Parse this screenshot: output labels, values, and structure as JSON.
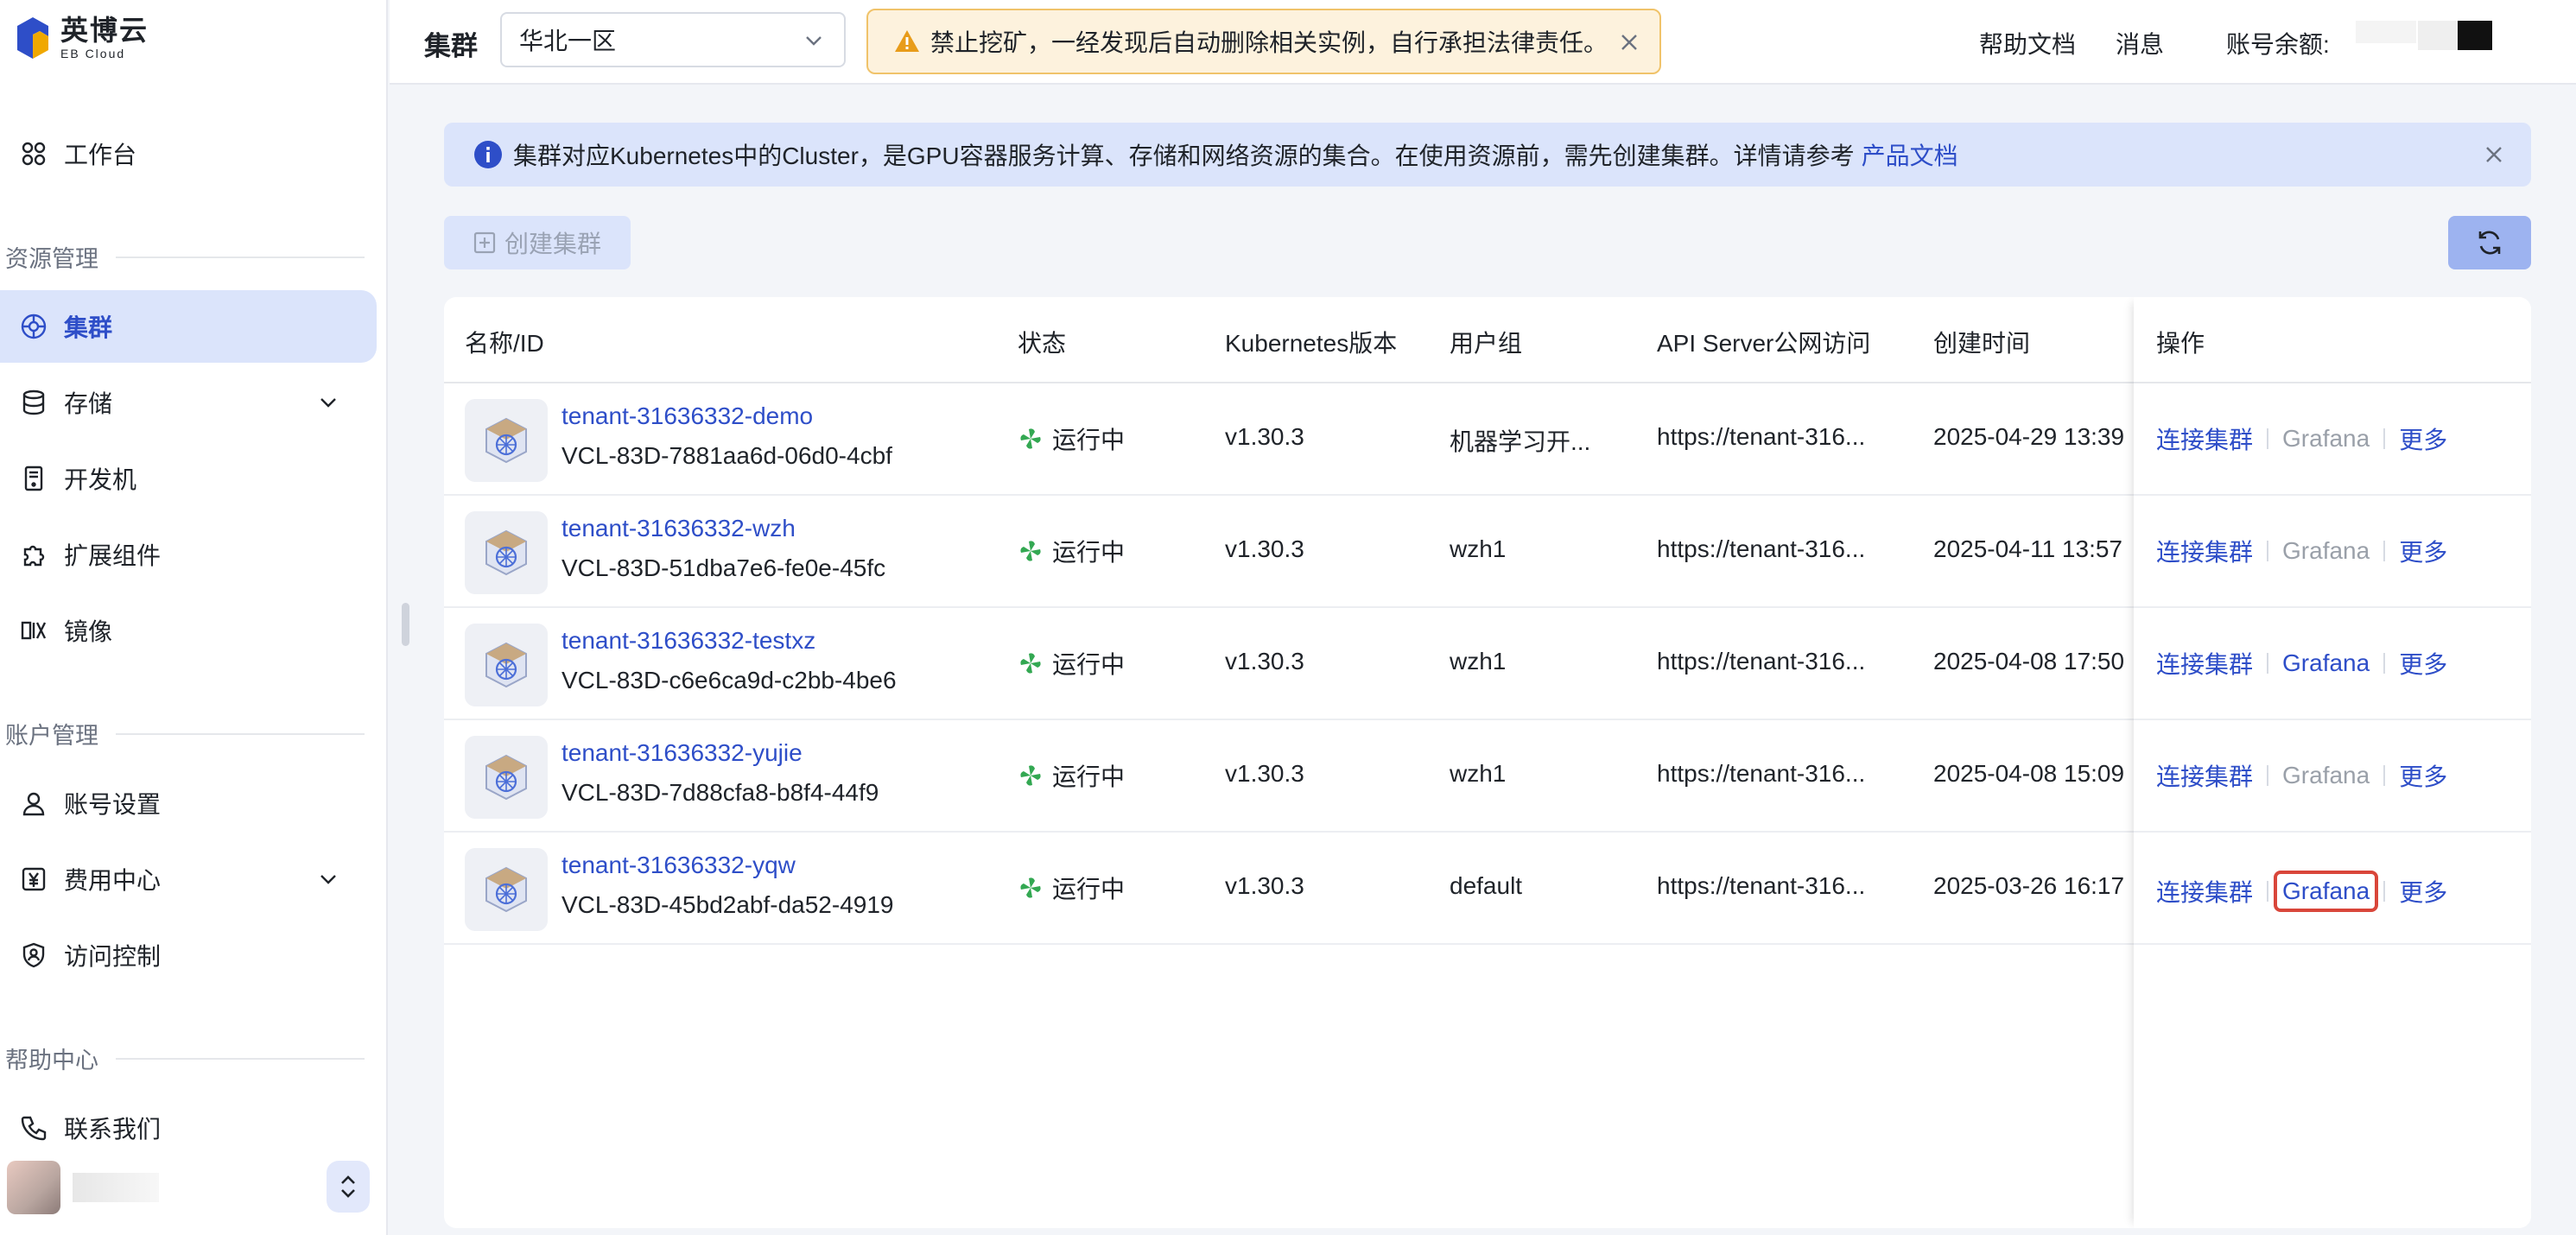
{
  "brand": {
    "name_cn": "英博云",
    "name_en": "EB Cloud",
    "color": "#2e4ec8"
  },
  "sidebar": {
    "workbench": "工作台",
    "section_resource": "资源管理",
    "items_resource": [
      {
        "label": "集群",
        "icon": "cluster-icon",
        "active": true
      },
      {
        "label": "存储",
        "icon": "database-icon",
        "expandable": true
      },
      {
        "label": "开发机",
        "icon": "device-icon"
      },
      {
        "label": "扩展组件",
        "icon": "puzzle-icon"
      },
      {
        "label": "镜像",
        "icon": "image-icon"
      }
    ],
    "section_account": "账户管理",
    "items_account": [
      {
        "label": "账号设置",
        "icon": "user-icon"
      },
      {
        "label": "费用中心",
        "icon": "yen-icon",
        "expandable": true
      },
      {
        "label": "访问控制",
        "icon": "shield-user-icon"
      }
    ],
    "section_help": "帮助中心",
    "items_help": [
      {
        "label": "联系我们",
        "icon": "phone-icon"
      }
    ]
  },
  "header": {
    "title": "集群",
    "region": "华北一区",
    "warning": "禁止挖矿，一经发现后自动删除相关实例，自行承担法律责任。",
    "help_docs": "帮助文档",
    "messages": "消息",
    "balance_label": "账号余额:"
  },
  "info_banner": {
    "text": "集群对应Kubernetes中的Cluster，是GPU容器服务计算、存储和网络资源的集合。在使用资源前，需先创建集群。详情请参考",
    "link": "产品文档"
  },
  "toolbar": {
    "create_label": "创建集群"
  },
  "table": {
    "columns": [
      "名称/ID",
      "状态",
      "Kubernetes版本",
      "用户组",
      "API Server公网访问",
      "创建时间",
      "操作"
    ],
    "rows": [
      {
        "name": "tenant-31636332-demo",
        "id": "VCL-83D-7881aa6d-06d0-4cbf",
        "status": "运行中",
        "version": "v1.30.3",
        "group": "机器学习开...",
        "api": "https://tenant-316...",
        "created": "2025-04-29 13:39",
        "grafana_enabled": false
      },
      {
        "name": "tenant-31636332-wzh",
        "id": "VCL-83D-51dba7e6-fe0e-45fc",
        "status": "运行中",
        "version": "v1.30.3",
        "group": "wzh1",
        "api": "https://tenant-316...",
        "created": "2025-04-11 13:57",
        "grafana_enabled": false
      },
      {
        "name": "tenant-31636332-testxz",
        "id": "VCL-83D-c6e6ca9d-c2bb-4be6",
        "status": "运行中",
        "version": "v1.30.3",
        "group": "wzh1",
        "api": "https://tenant-316...",
        "created": "2025-04-08 17:50",
        "grafana_enabled": true
      },
      {
        "name": "tenant-31636332-yujie",
        "id": "VCL-83D-7d88cfa8-b8f4-44f9",
        "status": "运行中",
        "version": "v1.30.3",
        "group": "wzh1",
        "api": "https://tenant-316...",
        "created": "2025-04-08 15:09",
        "grafana_enabled": false
      },
      {
        "name": "tenant-31636332-yqw",
        "id": "VCL-83D-45bd2abf-da52-4919",
        "status": "运行中",
        "version": "v1.30.3",
        "group": "default",
        "api": "https://tenant-316...",
        "created": "2025-03-26 16:17",
        "grafana_enabled": true,
        "highlighted": true
      }
    ],
    "actions": {
      "connect": "连接集群",
      "grafana": "Grafana",
      "more": "更多"
    }
  }
}
